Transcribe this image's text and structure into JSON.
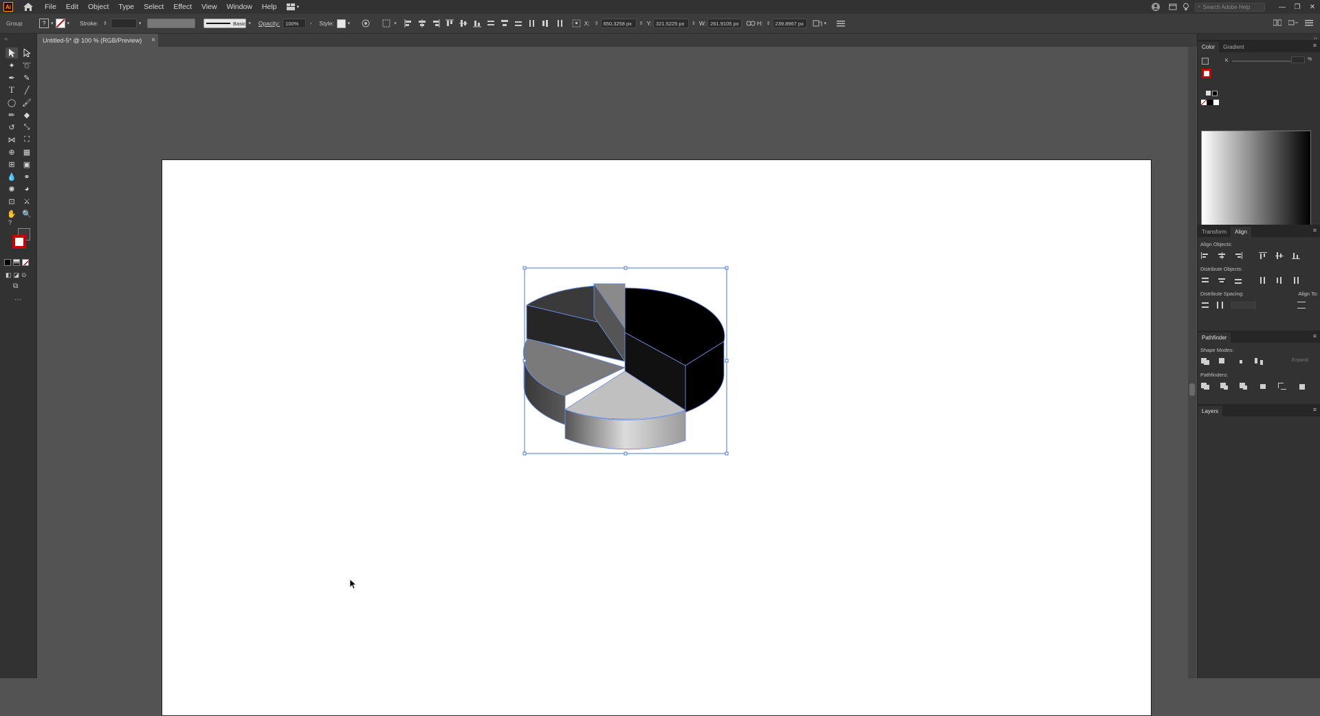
{
  "app": {
    "logo": "Ai",
    "menu": [
      "File",
      "Edit",
      "Object",
      "Type",
      "Select",
      "Effect",
      "View",
      "Window",
      "Help"
    ],
    "search_placeholder": "Search Adobe Help",
    "window_controls": [
      "—",
      "❐",
      "✕"
    ]
  },
  "control_bar": {
    "selection_label": "Group",
    "stroke_label": "Stroke:",
    "stroke_style": "Basic",
    "opacity_label": "Opacity:",
    "opacity_value": "100%",
    "style_label": "Style:",
    "x_label": "X:",
    "x_value": "650.3258 px",
    "y_label": "Y:",
    "y_value": "321.5225 px",
    "w_label": "W:",
    "w_value": "261.9105 px",
    "h_label": "H:",
    "h_value": "239.8967 px"
  },
  "document": {
    "tab_title": "Untitled-5* @ 100 % (RGB/Preview)"
  },
  "panels": {
    "top_tabs": [
      "Color",
      "Gradient"
    ],
    "color_k_label": "K",
    "color_k_unit": "%",
    "mid_tabs": [
      "Transform",
      "Align"
    ],
    "align_objects": "Align Objects:",
    "distribute_objects": "Distribute Objects:",
    "distribute_spacing": "Distribute Spacing:",
    "align_to": "Align To:",
    "pathfinder_tab": "Pathfinder",
    "shape_modes": "Shape Modes:",
    "expand_button": "Expand",
    "pathfinders": "Pathfinders:",
    "layers_tab": "Layers"
  },
  "colors": {
    "accent_selection": "#4a78d4",
    "stroke_none_red": "#cc0000",
    "logo_orange": "#ff9a00"
  }
}
